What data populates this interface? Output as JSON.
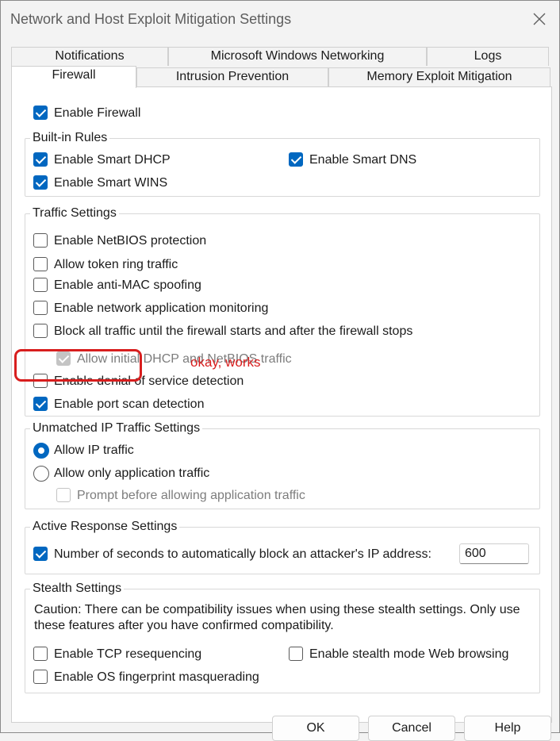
{
  "window": {
    "title": "Network and Host Exploit Mitigation Settings"
  },
  "tabs": {
    "notifications": "Notifications",
    "ms_networking": "Microsoft Windows Networking",
    "logs": "Logs",
    "firewall": "Firewall",
    "intrusion_prevention": "Intrusion Prevention",
    "memory_exploit": "Memory Exploit Mitigation",
    "active": "Firewall"
  },
  "firewall": {
    "enable_firewall": {
      "label": "Enable Firewall",
      "checked": true
    }
  },
  "builtin_rules": {
    "legend": "Built-in Rules",
    "smart_dhcp": {
      "label": "Enable Smart DHCP",
      "checked": true
    },
    "smart_dns": {
      "label": "Enable Smart DNS",
      "checked": true
    },
    "smart_wins": {
      "label": "Enable Smart WINS",
      "checked": true
    }
  },
  "traffic_settings": {
    "legend": "Traffic Settings",
    "netbios": {
      "label": "Enable NetBIOS protection",
      "checked": false
    },
    "token_ring": {
      "label": "Allow token ring traffic",
      "checked": false
    },
    "anti_mac": {
      "label": "Enable anti-MAC spoofing",
      "checked": false
    },
    "app_monitoring": {
      "label": "Enable network application monitoring",
      "checked": false
    },
    "block_all": {
      "label": "Block all traffic until the firewall starts and after the firewall stops",
      "checked": false
    },
    "initial_dhcp": {
      "label": "Allow initial DHCP and NetBIOS traffic",
      "checked": true,
      "disabled": true
    },
    "dos_detection": {
      "label": "Enable denial of service detection",
      "checked": false
    },
    "port_scan": {
      "label": "Enable port scan detection",
      "checked": true
    }
  },
  "unmatched_ip": {
    "legend": "Unmatched IP Traffic Settings",
    "allow_ip": {
      "label": "Allow IP traffic",
      "selected": true
    },
    "allow_app_only": {
      "label": "Allow only application traffic",
      "selected": false
    },
    "prompt": {
      "label": "Prompt before allowing application traffic",
      "checked": false,
      "disabled": true
    }
  },
  "active_response": {
    "legend": "Active Response Settings",
    "block_seconds": {
      "label": "Number of seconds to automatically block an attacker's IP address:",
      "checked": true
    },
    "seconds_value": "600"
  },
  "stealth": {
    "legend": "Stealth Settings",
    "caution": "Caution: There can be compatibility issues when using these stealth settings. Only use these features after you have confirmed compatibility.",
    "tcp_reseq": {
      "label": "Enable TCP resequencing",
      "checked": false
    },
    "stealth_web": {
      "label": "Enable stealth mode Web browsing",
      "checked": false
    },
    "os_fingerprint": {
      "label": "Enable OS fingerprint masquerading",
      "checked": false
    }
  },
  "buttons": {
    "ok": "OK",
    "cancel": "Cancel",
    "help": "Help"
  },
  "annotation": {
    "text": "okay, works",
    "color": "#d81e1e"
  },
  "colors": {
    "accent": "#0067c0",
    "window_bg": "#f3f3f3"
  },
  "icons": {
    "close": "close-icon"
  }
}
